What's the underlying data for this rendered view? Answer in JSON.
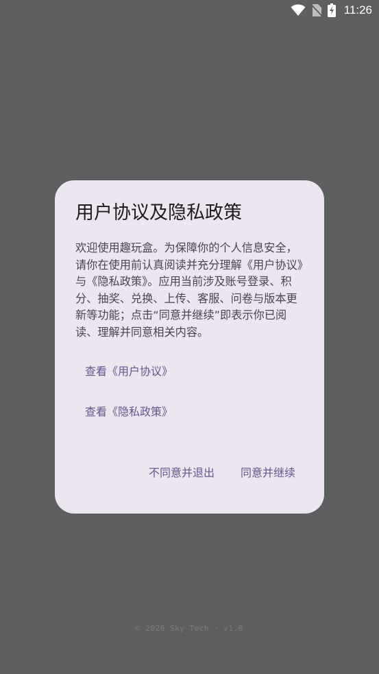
{
  "status_bar": {
    "time": "11:26",
    "icons": [
      "wifi-icon",
      "no-sim-icon",
      "battery-charging-icon"
    ]
  },
  "dialog": {
    "title": "用户协议及隐私政策",
    "body": "欢迎使用趣玩盒。为保障你的个人信息安全，请你在使用前认真阅读并充分理解《用户协议》与《隐私政策》。应用当前涉及账号登录、积分、抽奖、兑换、上传、客服、问卷与版本更新等功能；点击“同意并继续”即表示你已阅读、理解并同意相关内容。",
    "links": {
      "user_agreement": "查看《用户协议》",
      "privacy_policy": "查看《隐私政策》"
    },
    "actions": {
      "decline": "不同意并退出",
      "accept": "同意并继续"
    }
  },
  "footer": {
    "text": "© 2026 Sky Tech · v1.0"
  },
  "colors": {
    "scrim": "#5d5f60",
    "dialog_bg": "#ece6f0",
    "title": "#1d1b20",
    "body": "#49454f",
    "accent": "#65558f"
  }
}
